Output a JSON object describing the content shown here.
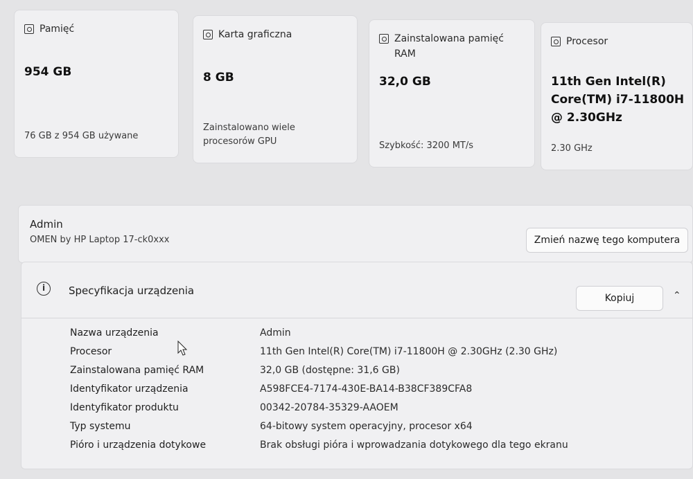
{
  "cards": [
    {
      "label": "Pamięć",
      "value": "954 GB",
      "sub": "76 GB z 954 GB używane",
      "icon": "storage-icon"
    },
    {
      "label": "Karta graficzna",
      "value": "8 GB",
      "sub": "Zainstalowano wiele procesorów GPU",
      "icon": "gpu-icon"
    },
    {
      "label": "Zainstalowana pamięć RAM",
      "value": "32,0 GB",
      "sub": "Szybkość: 3200 MT/s",
      "icon": "ram-icon"
    },
    {
      "label": "Procesor",
      "value": "11th Gen Intel(R) Core(TM) i7-11800H @ 2.30GHz",
      "sub": "2.30 GHz",
      "icon": "cpu-icon"
    }
  ],
  "device": {
    "name": "Admin",
    "model": "OMEN by HP Laptop 17-ck0xxx",
    "rename_label": "Zmień nazwę tego komputera"
  },
  "specs": {
    "title": "Specyfikacja urządzenia",
    "copy_label": "Kopiuj",
    "rows": [
      {
        "key": "Nazwa urządzenia",
        "value": "Admin"
      },
      {
        "key": "Procesor",
        "value": "11th Gen Intel(R) Core(TM) i7-11800H @ 2.30GHz (2.30 GHz)"
      },
      {
        "key": "Zainstalowana pamięć RAM",
        "value": "32,0 GB (dostępne: 31,6 GB)"
      },
      {
        "key": "Identyfikator urządzenia",
        "value": "A598FCE4-7174-430E-BA14-B38CF389CFA8"
      },
      {
        "key": "Identyfikator produktu",
        "value": "00342-20784-35329-AAOEM"
      },
      {
        "key": "Typ systemu",
        "value": "64-bitowy system operacyjny, procesor x64"
      },
      {
        "key": "Pióro i urządzenia dotykowe",
        "value": "Brak obsługi pióra i wprowadzania dotykowego dla tego ekranu"
      }
    ]
  }
}
